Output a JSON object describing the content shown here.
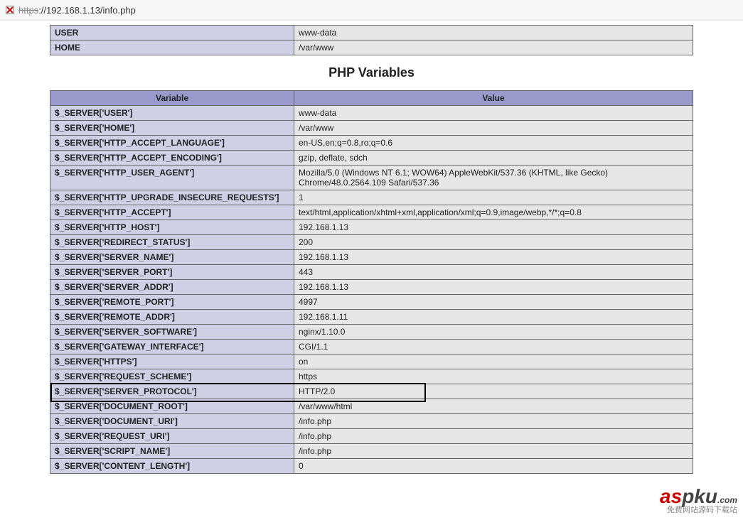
{
  "address": {
    "scheme": "https",
    "rest": "://192.168.1.13/info.php"
  },
  "env": {
    "rows": [
      {
        "k": "USER",
        "v": "www-data"
      },
      {
        "k": "HOME",
        "v": "/var/www"
      }
    ]
  },
  "section_title": "PHP Variables",
  "vars": {
    "header": {
      "variable": "Variable",
      "value": "Value"
    },
    "rows": [
      {
        "k": "$_SERVER['USER']",
        "v": "www-data"
      },
      {
        "k": "$_SERVER['HOME']",
        "v": "/var/www"
      },
      {
        "k": "$_SERVER['HTTP_ACCEPT_LANGUAGE']",
        "v": "en-US,en;q=0.8,ro;q=0.6"
      },
      {
        "k": "$_SERVER['HTTP_ACCEPT_ENCODING']",
        "v": "gzip, deflate, sdch"
      },
      {
        "k": "$_SERVER['HTTP_USER_AGENT']",
        "v": "Mozilla/5.0 (Windows NT 6.1; WOW64) AppleWebKit/537.36 (KHTML, like Gecko) Chrome/48.0.2564.109 Safari/537.36"
      },
      {
        "k": "$_SERVER['HTTP_UPGRADE_INSECURE_REQUESTS']",
        "v": "1"
      },
      {
        "k": "$_SERVER['HTTP_ACCEPT']",
        "v": "text/html,application/xhtml+xml,application/xml;q=0.9,image/webp,*/*;q=0.8"
      },
      {
        "k": "$_SERVER['HTTP_HOST']",
        "v": "192.168.1.13"
      },
      {
        "k": "$_SERVER['REDIRECT_STATUS']",
        "v": "200"
      },
      {
        "k": "$_SERVER['SERVER_NAME']",
        "v": "192.168.1.13"
      },
      {
        "k": "$_SERVER['SERVER_PORT']",
        "v": "443"
      },
      {
        "k": "$_SERVER['SERVER_ADDR']",
        "v": "192.168.1.13"
      },
      {
        "k": "$_SERVER['REMOTE_PORT']",
        "v": "4997"
      },
      {
        "k": "$_SERVER['REMOTE_ADDR']",
        "v": "192.168.1.11"
      },
      {
        "k": "$_SERVER['SERVER_SOFTWARE']",
        "v": "nginx/1.10.0"
      },
      {
        "k": "$_SERVER['GATEWAY_INTERFACE']",
        "v": "CGI/1.1"
      },
      {
        "k": "$_SERVER['HTTPS']",
        "v": "on"
      },
      {
        "k": "$_SERVER['REQUEST_SCHEME']",
        "v": "https"
      },
      {
        "k": "$_SERVER['SERVER_PROTOCOL']",
        "v": "HTTP/2.0",
        "highlight": true
      },
      {
        "k": "$_SERVER['DOCUMENT_ROOT']",
        "v": "/var/www/html"
      },
      {
        "k": "$_SERVER['DOCUMENT_URI']",
        "v": "/info.php"
      },
      {
        "k": "$_SERVER['REQUEST_URI']",
        "v": "/info.php"
      },
      {
        "k": "$_SERVER['SCRIPT_NAME']",
        "v": "/info.php"
      },
      {
        "k": "$_SERVER['CONTENT_LENGTH']",
        "v": "0"
      }
    ]
  },
  "watermark": {
    "brand": "aspku",
    "tld": ".com",
    "sub": "免费网站源码下载站"
  }
}
